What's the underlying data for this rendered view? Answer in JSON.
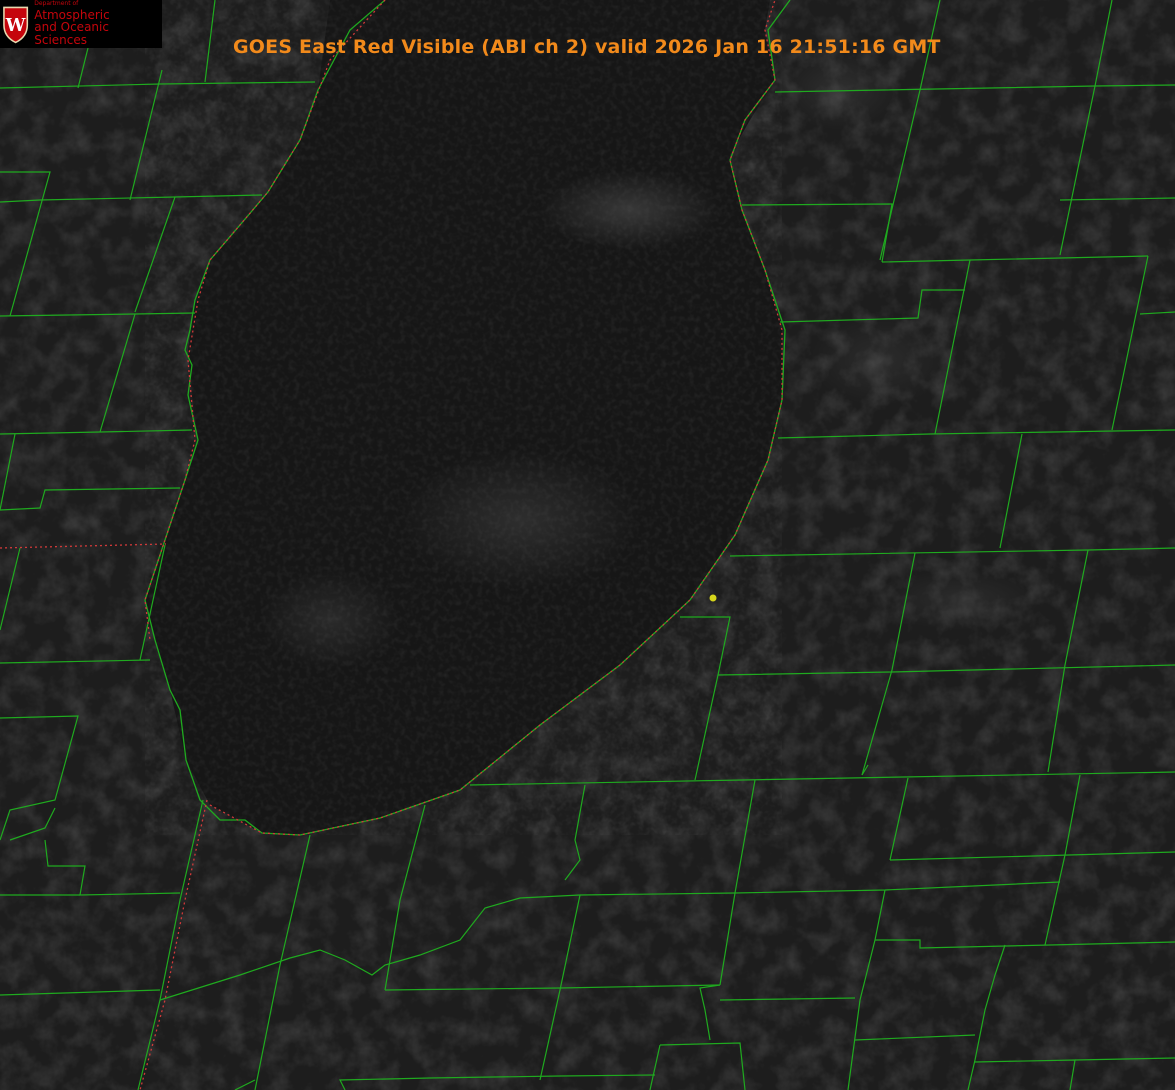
{
  "header": {
    "title": "GOES East Red Visible (ABI ch 2) valid 2026 Jan 16 21:51:16 GMT"
  },
  "logo": {
    "department": "Department of",
    "line1": "Atmospheric",
    "line2": "and Oceanic Sciences",
    "seal_letter": "W"
  },
  "colors": {
    "background": "#1c1c1c",
    "lake": "#161616",
    "county_lines": "#1faa1f",
    "state_lines": "#d23a3a",
    "title": "#f28a1b",
    "logo_text": "#c5050c",
    "marker": "#d6d61c"
  },
  "map": {
    "layers": [
      "satellite-visible",
      "county-boundaries",
      "state-boundaries",
      "shoreline",
      "station-marker"
    ]
  }
}
